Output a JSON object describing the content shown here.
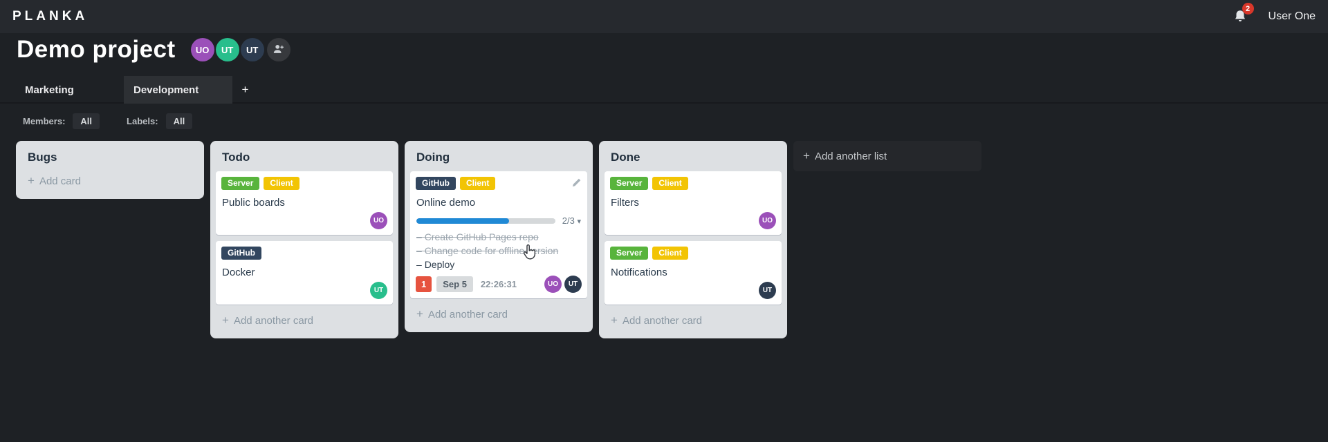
{
  "app": {
    "logo": "PLANKA",
    "user_name": "User One",
    "notification_count": "2"
  },
  "project": {
    "title": "Demo project",
    "members": [
      {
        "initials": "UO",
        "color": "#9b50b9"
      },
      {
        "initials": "UT",
        "color": "#28be8c"
      },
      {
        "initials": "UT",
        "color": "#2d3c50"
      }
    ]
  },
  "tabs": {
    "items": [
      {
        "label": "Marketing",
        "active": false
      },
      {
        "label": "Development",
        "active": true
      }
    ]
  },
  "filters": {
    "members_label": "Members:",
    "members_value": "All",
    "labels_label": "Labels:",
    "labels_value": "All"
  },
  "board": {
    "add_list_label": "Add another list",
    "lists": [
      {
        "title": "Bugs",
        "add_label": "Add card",
        "cards": []
      },
      {
        "title": "Todo",
        "add_label": "Add another card",
        "cards": [
          {
            "title": "Public boards",
            "labels": [
              {
                "text": "Server",
                "color": "#58b43c"
              },
              {
                "text": "Client",
                "color": "#f2c404"
              }
            ],
            "members": [
              {
                "initials": "UO",
                "color": "#9b50b9"
              }
            ]
          },
          {
            "title": "Docker",
            "labels": [
              {
                "text": "GitHub",
                "color": "#32465f"
              }
            ],
            "members": [
              {
                "initials": "UT",
                "color": "#28be8c"
              }
            ]
          }
        ]
      },
      {
        "title": "Doing",
        "add_label": "Add another card",
        "cards": [
          {
            "title": "Online demo",
            "labels": [
              {
                "text": "GitHub",
                "color": "#32465f"
              },
              {
                "text": "Client",
                "color": "#f2c404"
              }
            ],
            "checklist": {
              "summary": "2/3",
              "progress_width": "66.7%",
              "chevron": "▾",
              "tasks": [
                {
                  "text": "Create GitHub Pages repo",
                  "done": true
                },
                {
                  "text": "Change code for offline version",
                  "done": true
                },
                {
                  "text": "Deploy",
                  "done": false
                }
              ]
            },
            "notification_badge": "1",
            "due_date": "Sep 5",
            "timer": "22:26:31",
            "members": [
              {
                "initials": "UO",
                "color": "#9b50b9"
              },
              {
                "initials": "UT",
                "color": "#2d3c50"
              }
            ]
          }
        ]
      },
      {
        "title": "Done",
        "add_label": "Add another card",
        "cards": [
          {
            "title": "Filters",
            "labels": [
              {
                "text": "Server",
                "color": "#58b43c"
              },
              {
                "text": "Client",
                "color": "#f2c404"
              }
            ],
            "members": [
              {
                "initials": "UO",
                "color": "#9b50b9"
              }
            ]
          },
          {
            "title": "Notifications",
            "labels": [
              {
                "text": "Server",
                "color": "#58b43c"
              },
              {
                "text": "Client",
                "color": "#f2c404"
              }
            ],
            "members": [
              {
                "initials": "UT",
                "color": "#2d3c50"
              }
            ]
          }
        ]
      }
    ]
  },
  "icons": {
    "bell": "bell-icon",
    "add_member": "person-plus-icon",
    "tab_add": "plus-icon",
    "card_edit": "pencil-icon",
    "checklist_collapse": "chevron-down-icon",
    "mouse": "hand-cursor"
  },
  "colors": {
    "topbar_bg": "#26292e",
    "page_bg": "#1e2125",
    "list_bg": "#dde0e3",
    "active_tab_bg": "#2d3034",
    "progress_bar": "#2089d5",
    "notification_badge": "#d8372a",
    "card_red_badge": "#e6533f",
    "label_green": "#58b43c",
    "label_yellow": "#f2c404",
    "label_navy": "#32465f"
  }
}
